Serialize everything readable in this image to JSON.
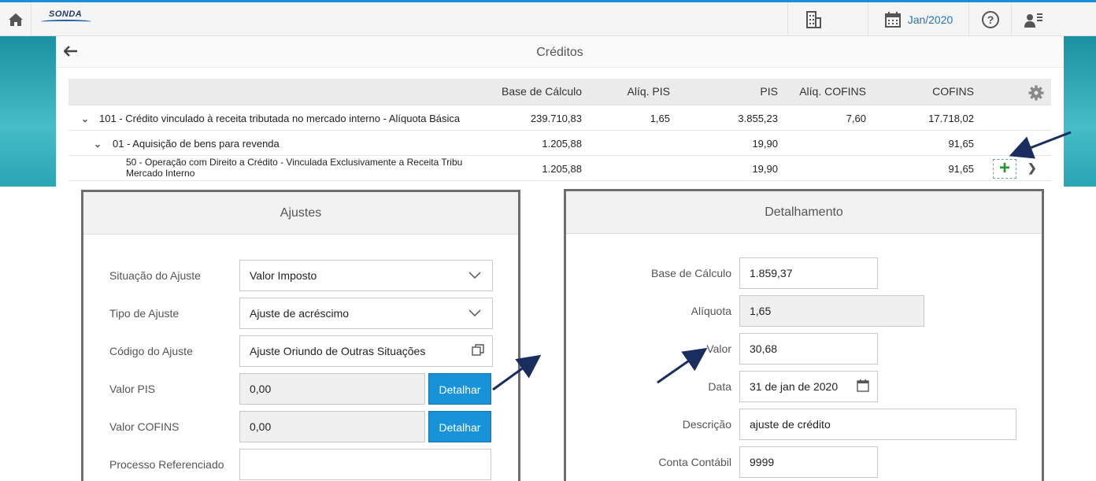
{
  "topbar": {
    "home_icon": "home-icon",
    "logo_text": "SONDA",
    "company_icon": "building-icon",
    "calendar_icon": "calendar-icon",
    "period": "Jan/2020",
    "help_icon": "question-circle-icon",
    "user_icon": "user-menu-icon"
  },
  "page": {
    "title": "Créditos",
    "back_icon": "arrow-left-icon"
  },
  "grid": {
    "headers": {
      "base": "Base de Cálculo",
      "aliq_pis": "Alíq. PIS",
      "pis": "PIS",
      "aliq_cofins": "Alíq. COFINS",
      "cofins": "COFINS"
    },
    "rows": [
      {
        "label": "101 - Crédito vinculado à receita tributada no mercado interno - Alíquota Básica",
        "base": "239.710,83",
        "aliq_pis": "1,65",
        "pis": "3.855,23",
        "aliq_cofins": "7,60",
        "cofins": "17.718,02"
      },
      {
        "label": "01 - Aquisição de bens para revenda",
        "base": "1.205,88",
        "aliq_pis": "",
        "pis": "19,90",
        "aliq_cofins": "",
        "cofins": "91,65"
      },
      {
        "label_line1": "50 - Operação com Direito a Crédito - Vinculada Exclusivamente a Receita Tribu",
        "label_line2": "Mercado Interno",
        "base": "1.205,88",
        "aliq_pis": "",
        "pis": "19,90",
        "aliq_cofins": "",
        "cofins": "91,65"
      }
    ],
    "add_symbol": "+",
    "next_symbol": "❯"
  },
  "ajustes": {
    "title": "Ajustes",
    "situacao_label": "Situação do Ajuste",
    "situacao_value": "Valor Imposto",
    "tipo_label": "Tipo de Ajuste",
    "tipo_value": "Ajuste de acréscimo",
    "codigo_label": "Código do Ajuste",
    "codigo_value": "Ajuste Oriundo de Outras Situações",
    "valor_pis_label": "Valor PIS",
    "valor_pis_value": "0,00",
    "valor_cofins_label": "Valor COFINS",
    "valor_cofins_value": "0,00",
    "detalhar_label": "Detalhar",
    "processo_label": "Processo Referenciado",
    "processo_value": ""
  },
  "detalhamento": {
    "title": "Detalhamento",
    "base_label": "Base de Cálculo",
    "base_value": "1.859,37",
    "aliquota_label": "Alíquota",
    "aliquota_value": "1,65",
    "valor_label": "Valor",
    "valor_value": "30,68",
    "data_label": "Data",
    "data_value": "31 de jan de 2020",
    "descricao_label": "Descrição",
    "descricao_value": "ajuste de crédito",
    "conta_label": "Conta Contábil",
    "conta_value": "9999"
  },
  "colors": {
    "accent": "#1893d8",
    "annotation_arrow": "#1b2d5e",
    "add_green": "#1e9b2e"
  }
}
